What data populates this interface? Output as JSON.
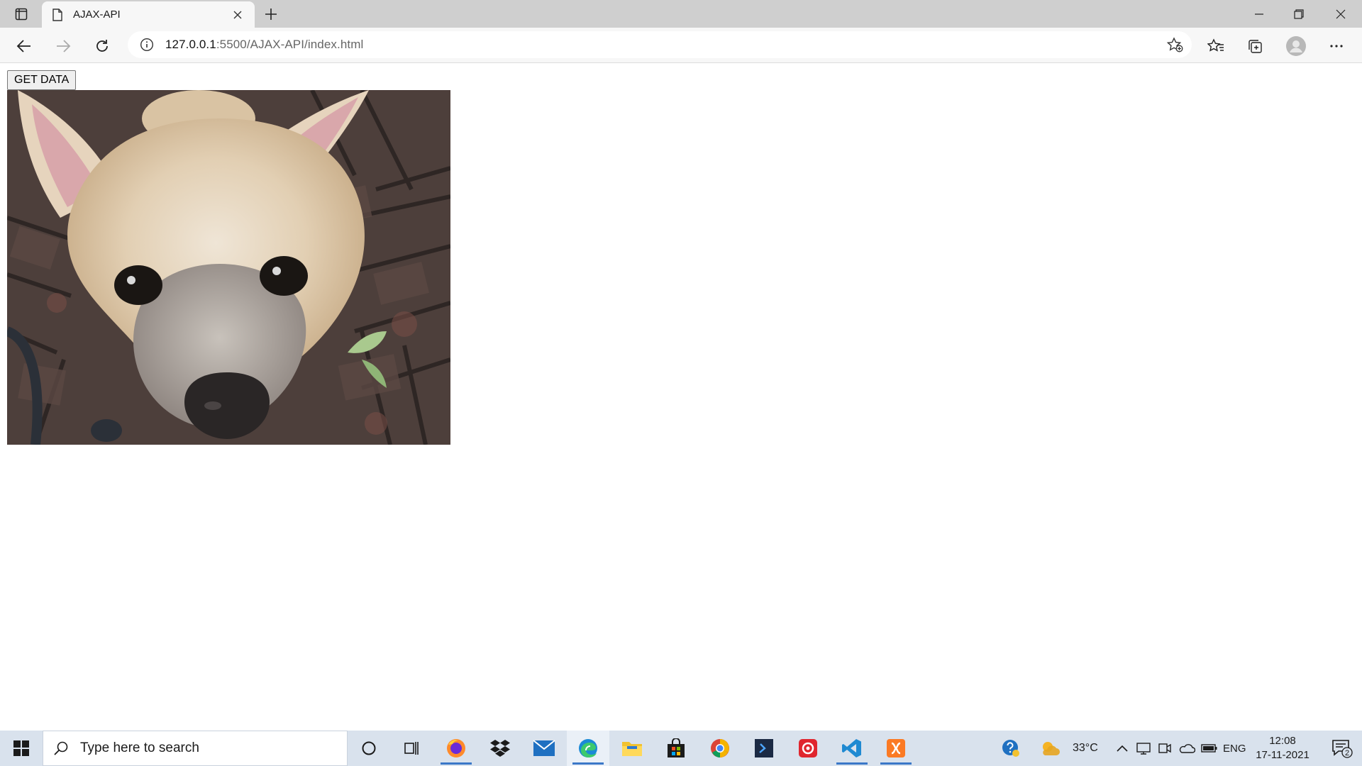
{
  "browser": {
    "tab": {
      "title": "AJAX-API"
    },
    "address": {
      "host": "127.0.0.1",
      "path": ":5500/AJAX-API/index.html"
    }
  },
  "page": {
    "button_label": "GET DATA",
    "image": "photo of a cream-colored puppy looking up at the camera on a brick pavement"
  },
  "taskbar": {
    "search_placeholder": "Type here to search",
    "weather_temp": "33°C",
    "language": "ENG",
    "time": "12:08",
    "date": "17-11-2021",
    "notification_count": "2"
  },
  "icons": [
    "tab-actions-icon",
    "page-icon",
    "close-icon",
    "plus-icon",
    "minimize-icon",
    "restore-icon",
    "window-close-icon",
    "back-icon",
    "forward-icon",
    "refresh-icon",
    "info-icon",
    "favorite-add-icon",
    "favorites-icon",
    "collections-icon",
    "profile-icon",
    "more-icon",
    "windows-icon",
    "search-icon",
    "cortana-icon",
    "task-view-icon",
    "firefox-icon",
    "dropbox-icon",
    "mail-icon",
    "edge-icon",
    "file-explorer-icon",
    "store-icon",
    "chrome-icon",
    "powershell-icon",
    "app-icon",
    "vscode-icon",
    "xampp-icon",
    "help-icon",
    "weather-icon",
    "chevron-up-icon",
    "device-icon",
    "meet-icon",
    "onedrive-icon",
    "battery-icon",
    "notification-icon"
  ]
}
